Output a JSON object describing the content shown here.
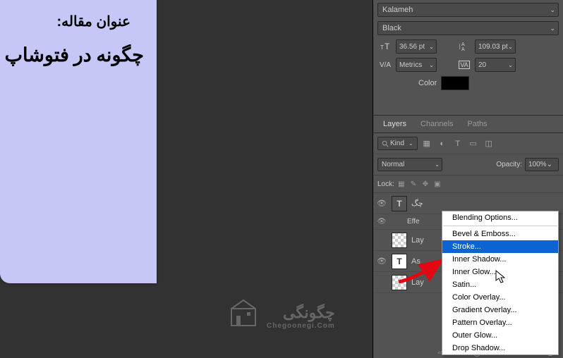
{
  "document": {
    "title": "عنوان مقاله:",
    "body": "چگونه در فتوشاپ دو"
  },
  "watermark": {
    "name": "چگونگی",
    "url": "Chegoonegi.Com"
  },
  "character_panel": {
    "font_family": "Kalameh",
    "font_style": "Black",
    "font_size": "36.56 pt",
    "leading": "109.03 pt",
    "kerning": "Metrics",
    "tracking": "20",
    "color_label": "Color"
  },
  "layers_panel": {
    "tabs": {
      "layers": "Layers",
      "channels": "Channels",
      "paths": "Paths"
    },
    "filter_label": "Kind",
    "blend_mode": "Normal",
    "opacity_label": "Opacity:",
    "opacity_value": "100%",
    "lock_label": "Lock:",
    "rows": {
      "text1": "چگ",
      "fx1": "Effe",
      "lay1": "Lay",
      "text2": "As",
      "lay2": "Lay"
    }
  },
  "context_menu": {
    "blending_options": "Blending Options...",
    "bevel_emboss": "Bevel & Emboss...",
    "stroke": "Stroke...",
    "inner_shadow": "Inner Shadow...",
    "inner_glow": "Inner Glow...",
    "satin": "Satin...",
    "color_overlay": "Color Overlay...",
    "gradient_overlay": "Gradient Overlay...",
    "pattern_overlay": "Pattern Overlay...",
    "outer_glow": "Outer Glow...",
    "drop_shadow": "Drop Shadow..."
  }
}
